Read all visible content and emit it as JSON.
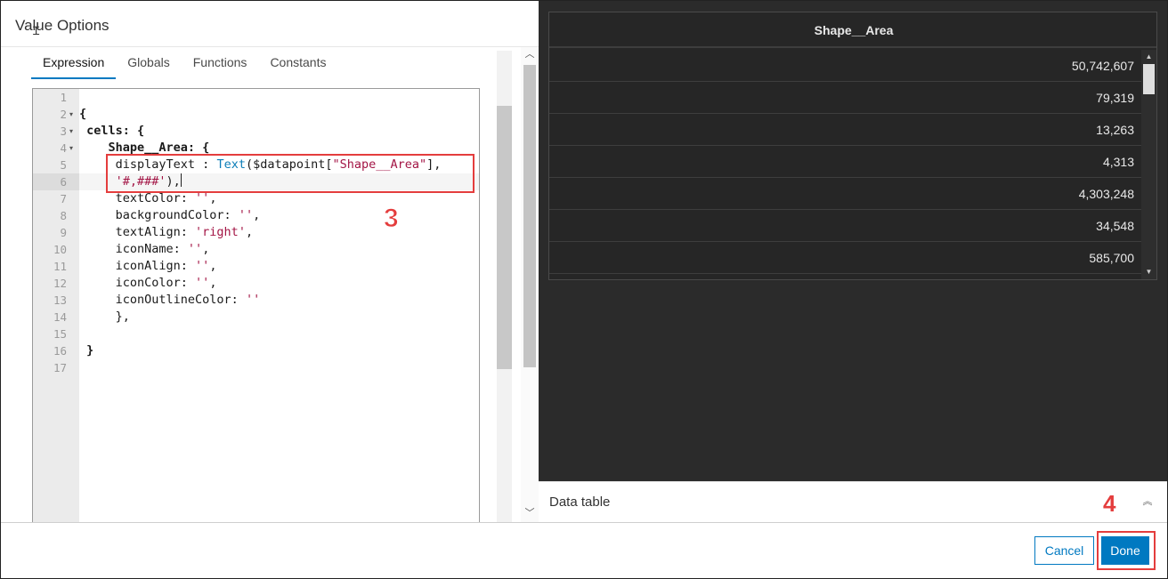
{
  "dialog": {
    "title": "Value Options",
    "tabs": [
      {
        "label": "Expression",
        "active": true
      },
      {
        "label": "Globals",
        "active": false
      },
      {
        "label": "Functions",
        "active": false
      },
      {
        "label": "Constants",
        "active": false
      }
    ]
  },
  "editor": {
    "line_numbers": [
      "1",
      "2",
      "3",
      "4",
      "5",
      "6",
      "7",
      "8",
      "9",
      "10",
      "11",
      "12",
      "13",
      "14",
      "15",
      "16",
      "17"
    ],
    "fold_markers": {
      "2": "▾",
      "3": "▾",
      "4": "▾"
    },
    "active_line": 6,
    "lines": {
      "l2": "{",
      "l3": " cells: {",
      "l4": "    Shape__Area: {",
      "l5_a": "     displayText : ",
      "l5_fn": "Text",
      "l5_b": "($datapoint[",
      "l5_str": "\"Shape__Area\"",
      "l5_c": "],",
      "l6_str": "'#,###'",
      "l6_b": "),",
      "l7_a": "     textColor: ",
      "l7_str": "''",
      "l7_b": ",",
      "l8_a": "     backgroundColor: ",
      "l8_str": "''",
      "l8_b": ",",
      "l9_a": "     textAlign: ",
      "l9_str": "'right'",
      "l9_b": ",",
      "l10_a": "     iconName: ",
      "l10_str": "''",
      "l10_b": ",",
      "l11_a": "     iconAlign: ",
      "l11_str": "''",
      "l11_b": ",",
      "l12_a": "     iconColor: ",
      "l12_str": "''",
      "l12_b": ",",
      "l13_a": "     iconOutlineColor: ",
      "l13_str": "''",
      "l14": "     },",
      "l16": " }"
    }
  },
  "annotations": {
    "step3": "3",
    "step4": "4"
  },
  "preview": {
    "column_header": "Shape__Area",
    "rows": [
      "50,742,607",
      "79,319",
      "13,263",
      "4,313",
      "4,303,248",
      "34,548",
      "585,700"
    ]
  },
  "data_table_bar": {
    "label": "Data table"
  },
  "footer": {
    "cancel_label": "Cancel",
    "done_label": "Done"
  },
  "colors": {
    "accent": "#0079c1",
    "annotation": "#e43d3d",
    "preview_bg": "#2b2b2b",
    "code_string": "#a31545",
    "code_function": "#0b7db8"
  }
}
